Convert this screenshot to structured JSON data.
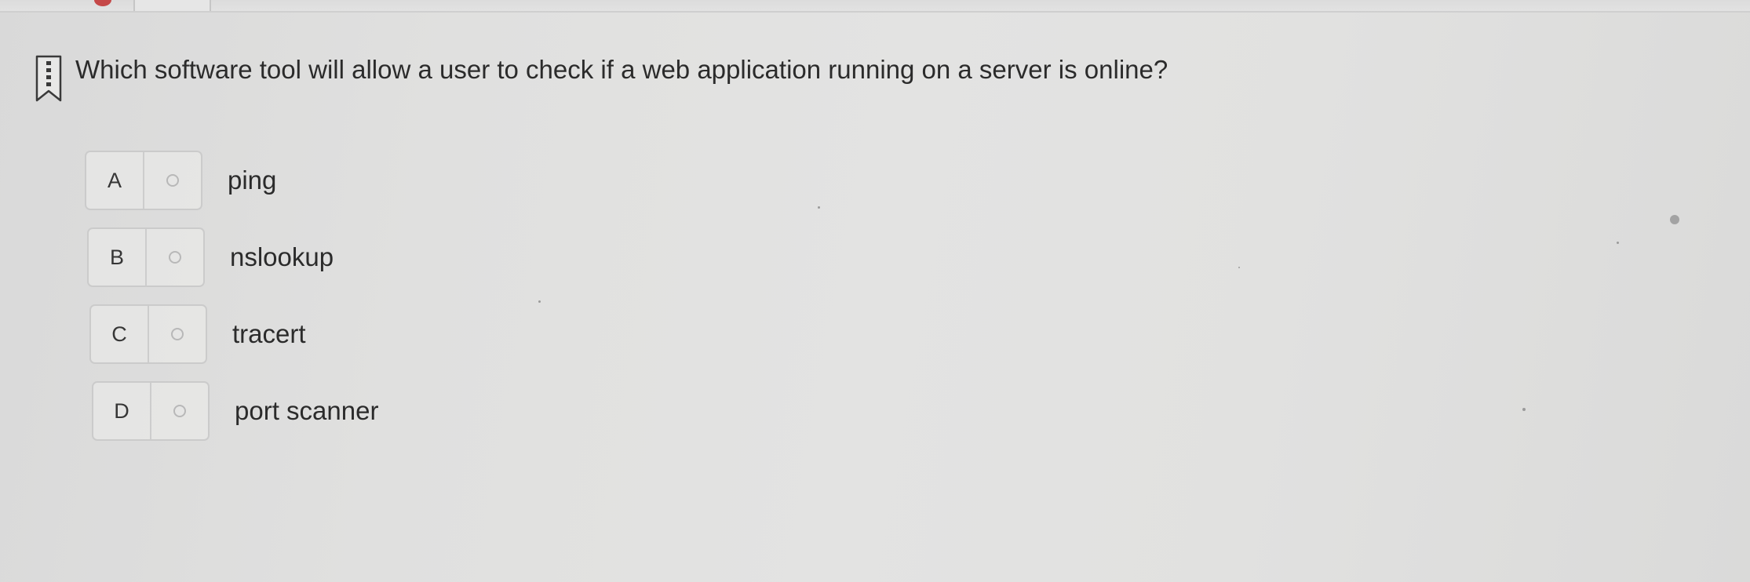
{
  "question": {
    "text": "Which software tool will allow a user to check if a web application running on a server is online?",
    "icon": "bookmark-icon"
  },
  "options": [
    {
      "letter": "A",
      "text": "ping"
    },
    {
      "letter": "B",
      "text": "nslookup"
    },
    {
      "letter": "C",
      "text": "tracert"
    },
    {
      "letter": "D",
      "text": "port scanner"
    }
  ],
  "colors": {
    "background": "#e0e0df",
    "text": "#2b2b2b",
    "border": "#cbcbcb",
    "top_indicator": "#c54848"
  }
}
